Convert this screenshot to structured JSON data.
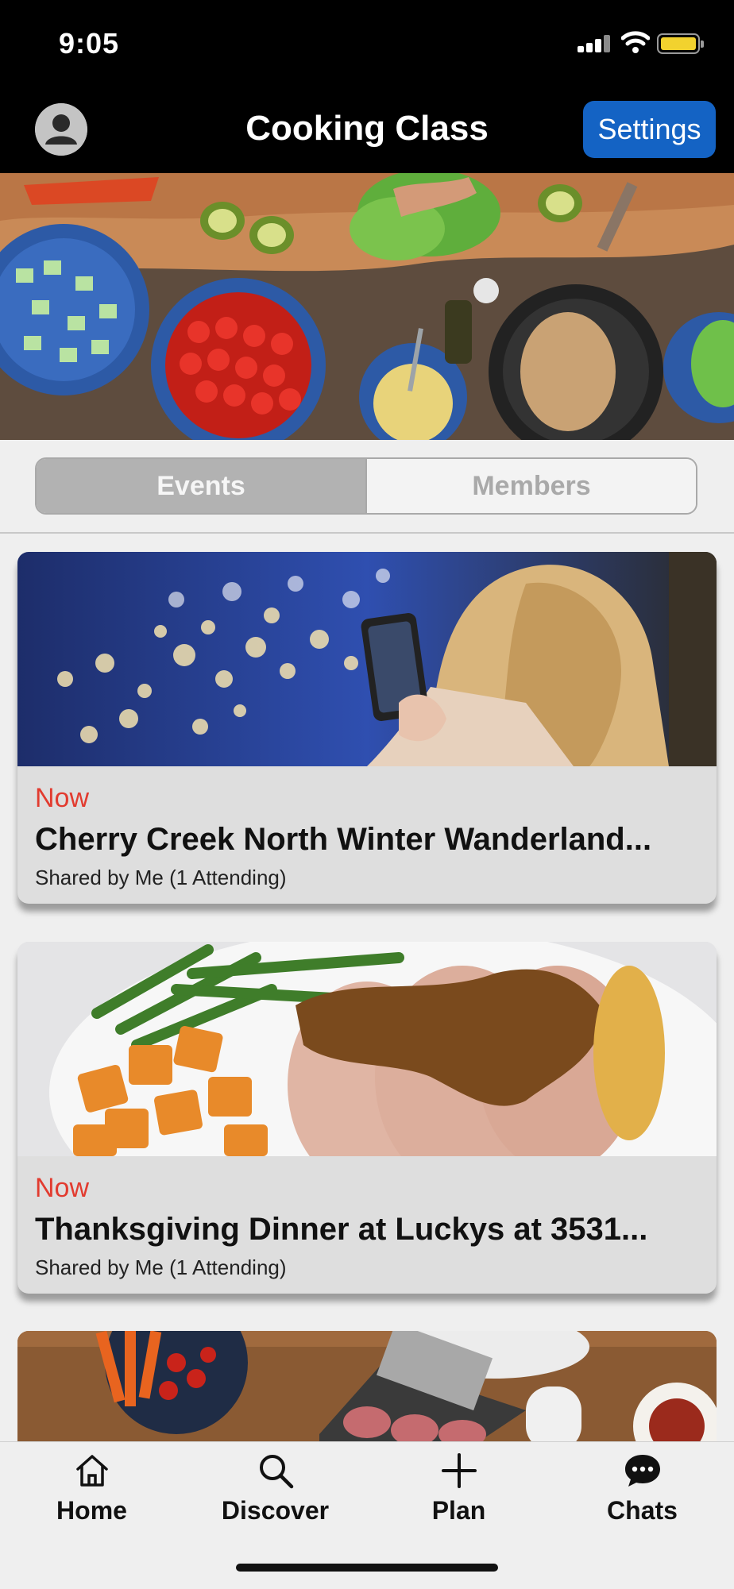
{
  "status_bar": {
    "time": "9:05"
  },
  "header": {
    "title": "Cooking Class",
    "settings_label": "Settings"
  },
  "segments": [
    {
      "label": "Events",
      "selected": true
    },
    {
      "label": "Members",
      "selected": false
    }
  ],
  "events": [
    {
      "status": "Now",
      "title": "Cherry Creek North Winter Wanderland...",
      "meta": "Shared by Me (1 Attending)"
    },
    {
      "status": "Now",
      "title": "Thanksgiving Dinner at Luckys at 3531...",
      "meta": "Shared by Me (1 Attending)"
    }
  ],
  "tabs": [
    {
      "label": "Home",
      "icon": "home-icon"
    },
    {
      "label": "Discover",
      "icon": "search-icon"
    },
    {
      "label": "Plan",
      "icon": "plus-icon"
    },
    {
      "label": "Chats",
      "icon": "chat-bubble-icon"
    }
  ],
  "colors": {
    "accent": "#1463c4",
    "status_now": "#e23b2f",
    "battery": "#f2d22e"
  }
}
